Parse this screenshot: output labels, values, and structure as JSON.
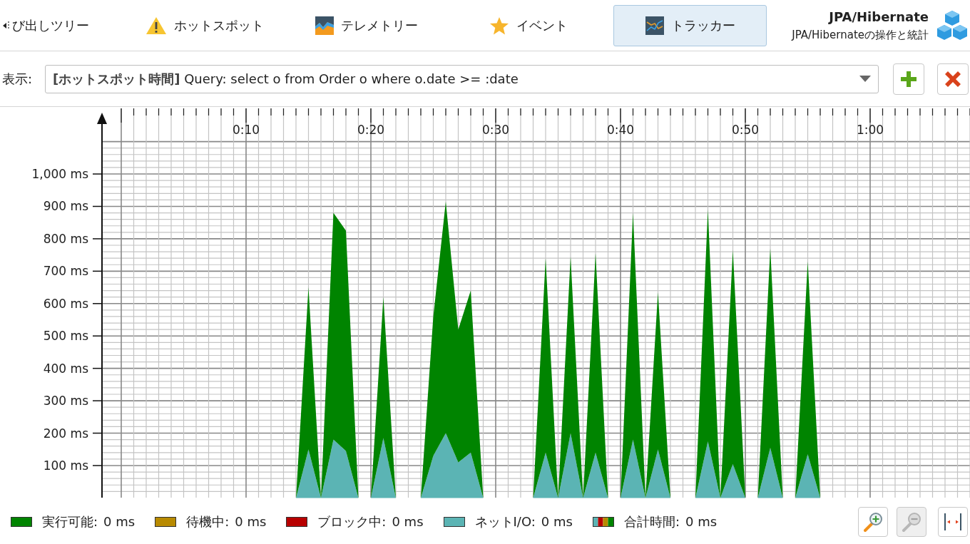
{
  "tabs": [
    {
      "label": "び出しツリー",
      "selected": false
    },
    {
      "label": "ホットスポット",
      "selected": false
    },
    {
      "label": "テレメトリー",
      "selected": false
    },
    {
      "label": "イベント",
      "selected": false
    },
    {
      "label": "トラッカー",
      "selected": true
    }
  ],
  "header": {
    "title": "JPA/Hibernate",
    "subtitle": "JPA/Hibernateの操作と統計"
  },
  "toolbar": {
    "label": "表示:",
    "value": "**[ホットスポット時間]** Query: select o from Order o where o.date >= :date"
  },
  "chart": {
    "chart_data": {
      "type": "area",
      "stacked": true,
      "x": [
        14,
        15,
        16,
        17,
        18,
        19,
        20,
        21,
        22,
        23,
        24,
        25,
        26,
        27,
        28,
        29,
        30,
        31,
        32,
        33,
        34,
        35,
        36,
        37,
        38,
        39,
        40,
        41,
        42,
        43,
        44,
        45,
        46,
        47,
        48,
        49,
        50,
        51,
        52,
        53,
        54,
        55,
        56
      ],
      "series": [
        {
          "color": "#5bb4b4",
          "values": [
            0,
            150,
            0,
            180,
            145,
            0,
            0,
            185,
            0,
            0,
            0,
            130,
            200,
            110,
            140,
            0,
            0,
            0,
            0,
            0,
            140,
            0,
            200,
            0,
            140,
            0,
            0,
            180,
            0,
            150,
            0,
            0,
            0,
            175,
            0,
            105,
            0,
            0,
            155,
            0,
            0,
            135,
            0
          ]
        },
        {
          "color": "#008400",
          "values": [
            0,
            500,
            0,
            700,
            680,
            0,
            0,
            435,
            0,
            0,
            0,
            430,
            715,
            410,
            500,
            0,
            0,
            0,
            0,
            0,
            600,
            0,
            545,
            0,
            615,
            0,
            0,
            700,
            0,
            485,
            0,
            0,
            0,
            715,
            0,
            660,
            0,
            0,
            615,
            0,
            0,
            595,
            0
          ]
        }
      ],
      "grid": true,
      "xlim": [
        0,
        68
      ],
      "ylim": [
        0,
        1100
      ],
      "xticks": [
        {
          "value": 10,
          "label": "0:10"
        },
        {
          "value": 20,
          "label": "0:20"
        },
        {
          "value": 30,
          "label": "0:30"
        },
        {
          "value": 40,
          "label": "0:40"
        },
        {
          "value": 50,
          "label": "0:50"
        },
        {
          "value": 60,
          "label": "1:00"
        }
      ],
      "yticks": [
        {
          "value": 100,
          "label": "100 ms"
        },
        {
          "value": 200,
          "label": "200 ms"
        },
        {
          "value": 300,
          "label": "300 ms"
        },
        {
          "value": 400,
          "label": "400 ms"
        },
        {
          "value": 500,
          "label": "500 ms"
        },
        {
          "value": 600,
          "label": "600 ms"
        },
        {
          "value": 700,
          "label": "700 ms"
        },
        {
          "value": 800,
          "label": "800 ms"
        },
        {
          "value": 900,
          "label": "900 ms"
        },
        {
          "value": 1000,
          "label": "1,000 ms"
        }
      ]
    }
  },
  "legend": [
    {
      "kind": "swatch",
      "color": "#008400",
      "label": "実行可能:",
      "value": "0 ms"
    },
    {
      "kind": "swatch",
      "color": "#b88a00",
      "label": "待機中:",
      "value": "0 ms"
    },
    {
      "kind": "swatch",
      "color": "#b80000",
      "label": "ブロック中:",
      "value": "0 ms"
    },
    {
      "kind": "swatch",
      "color": "#5bb4b4",
      "label": "ネットI/O:",
      "value": "0 ms"
    },
    {
      "kind": "total",
      "label": "合計時間:",
      "value": "0 ms"
    }
  ],
  "zoom_buttons": [
    {
      "kind": "zoom-in",
      "disabled": false
    },
    {
      "kind": "zoom-out",
      "disabled": true
    },
    {
      "kind": "fit",
      "disabled": false
    }
  ]
}
